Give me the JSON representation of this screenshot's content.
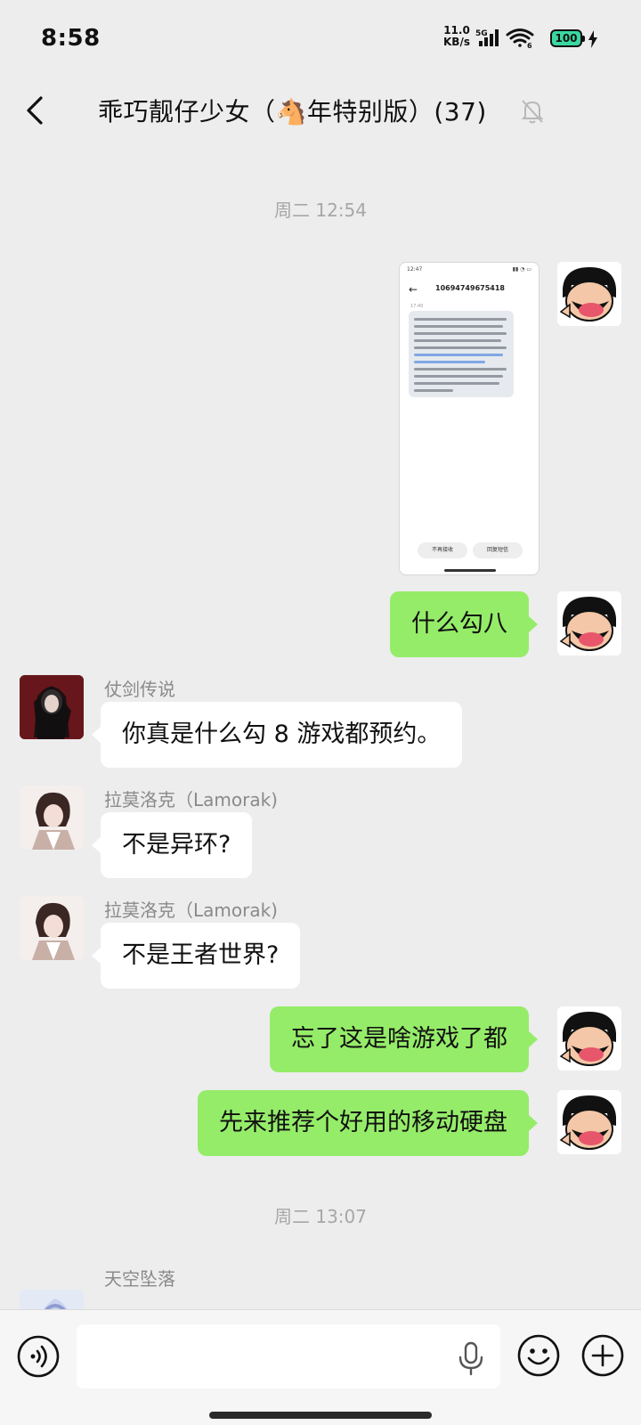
{
  "status_bar": {
    "time": "8:58",
    "net_speed_value": "11.0",
    "net_speed_unit": "KB/s",
    "network": "5G",
    "battery": "100",
    "wifi_badge": "6"
  },
  "header": {
    "title": "乖巧靓仔少女（🐴年特别版）(37)"
  },
  "messages": {
    "time_1": "周二 12:54",
    "time_2": "周二 13:07",
    "image_preview": {
      "time": "12:47",
      "number": "10694749675418",
      "sms_time": "17:40",
      "btn_left": "不再接收",
      "btn_right": "回复短信"
    },
    "m1": {
      "text": "什么勾八"
    },
    "m2": {
      "sender": "仗剑传说",
      "text": "你真是什么勾 8 游戏都预约。"
    },
    "m3": {
      "sender": "拉莫洛克（Lamorak)",
      "text": "不是异环?"
    },
    "m4": {
      "sender": "拉莫洛克（Lamorak)",
      "text": "不是王者世界?"
    },
    "m5": {
      "text": "忘了这是啥游戏了都"
    },
    "m6": {
      "text": "先来推荐个好用的移动硬盘"
    },
    "m7": {
      "sender": "天空坠落"
    }
  },
  "input": {
    "placeholder": ""
  },
  "colors": {
    "outgoing_bubble": "#95ec69",
    "incoming_bubble": "#ffffff",
    "background": "#ededed"
  }
}
